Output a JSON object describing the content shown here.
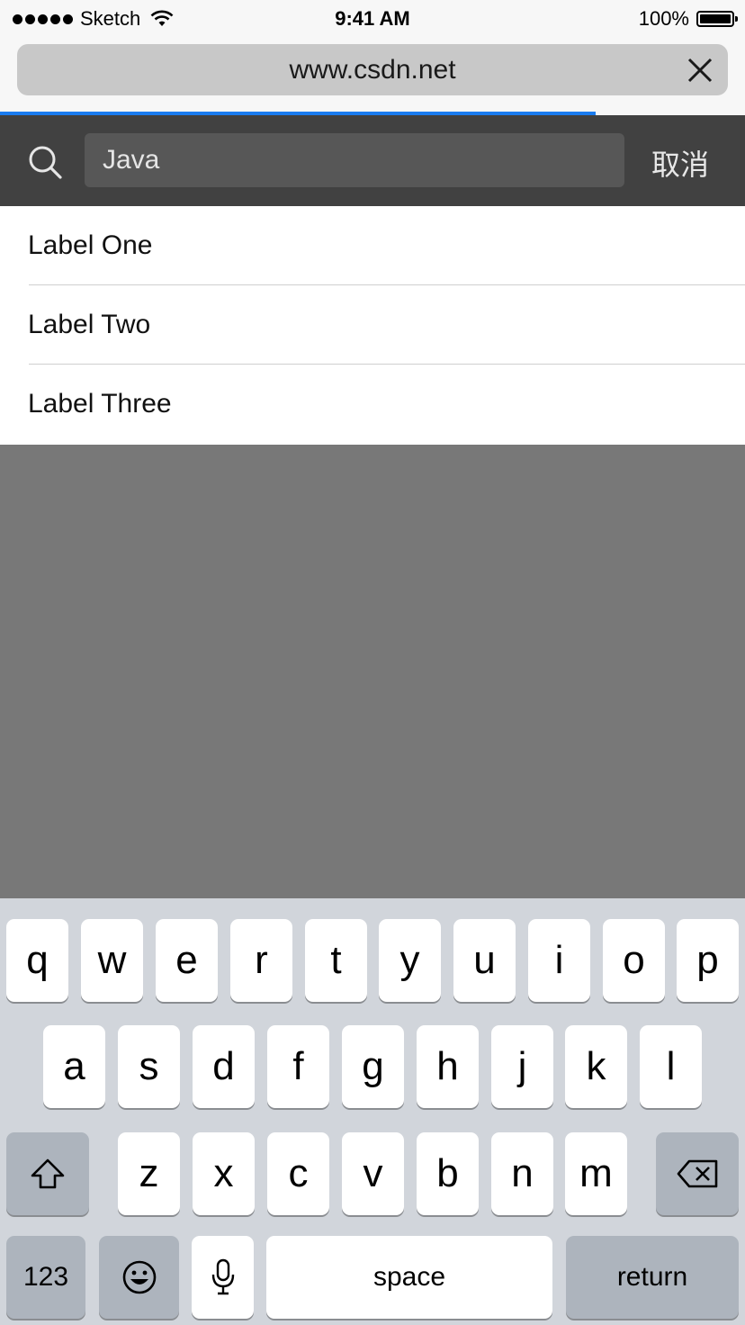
{
  "status_bar": {
    "carrier": "Sketch",
    "time": "9:41 AM",
    "battery": "100%"
  },
  "browser": {
    "url": "www.csdn.net",
    "load_progress": 0.8
  },
  "search": {
    "value": "Java",
    "cancel_label": "取消"
  },
  "list": {
    "items": [
      {
        "label": "Label One"
      },
      {
        "label": "Label Two"
      },
      {
        "label": "Label Three"
      }
    ]
  },
  "keyboard": {
    "row1": [
      "q",
      "w",
      "e",
      "r",
      "t",
      "y",
      "u",
      "i",
      "o",
      "p"
    ],
    "row2": [
      "a",
      "s",
      "d",
      "f",
      "g",
      "h",
      "j",
      "k",
      "l"
    ],
    "row3": [
      "z",
      "x",
      "c",
      "v",
      "b",
      "n",
      "m"
    ],
    "numbers_label": "123",
    "space_label": "space",
    "return_label": "return"
  },
  "colors": {
    "header_bg": "#414141",
    "progress": "#1a7cf0",
    "overlay": "#787878",
    "keyboard_bg": "#d1d5db"
  }
}
